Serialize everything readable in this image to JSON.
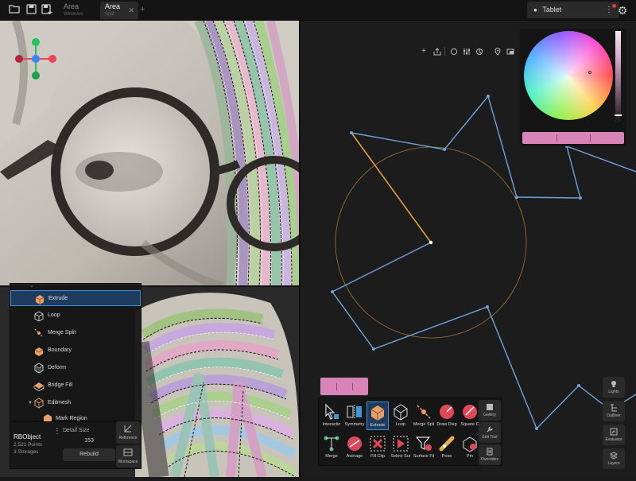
{
  "tabs": [
    {
      "title": "Area",
      "subtitle": "Windows"
    },
    {
      "title": "Area",
      "subtitle": "Split"
    }
  ],
  "tablet_label": "Tablet",
  "tools_tree": [
    {
      "label": "Extrude"
    },
    {
      "label": "Loop"
    },
    {
      "label": "Merge Split"
    },
    {
      "label": "Boundary"
    },
    {
      "label": "Deform"
    },
    {
      "label": "Bridge Fill"
    },
    {
      "label": "Editmesh"
    },
    {
      "label": "Mark Region"
    }
  ],
  "object_info": {
    "name": "RBObject",
    "points": "2,521 Points",
    "storages": "3 Storages",
    "detail_label": "Detail Size",
    "detail_value": "153",
    "rebuild_label": "Rebuild",
    "reference_label": "Reference",
    "workspace_label": "Workspace"
  },
  "shelf_row1": [
    "Interactio",
    "Symmetry",
    "Extrude",
    "Loop",
    "Merge Spli",
    "Draw Disp",
    "Square C"
  ],
  "shelf_row2": [
    "Merge",
    "Average",
    "Fill Clip",
    "Select Sur",
    "Surface Fil",
    "Pose",
    "Pin"
  ],
  "shelf_side": [
    "Gallery",
    "Edit Tool",
    "Overrides"
  ],
  "right_side": [
    "Lights",
    "Outliner",
    "Evaluator",
    "Layers"
  ],
  "colors": {
    "accent": "#3d8fd6",
    "curve": "#6fa2db",
    "circle": "#c48b3a",
    "swatch": "#d884b8"
  }
}
